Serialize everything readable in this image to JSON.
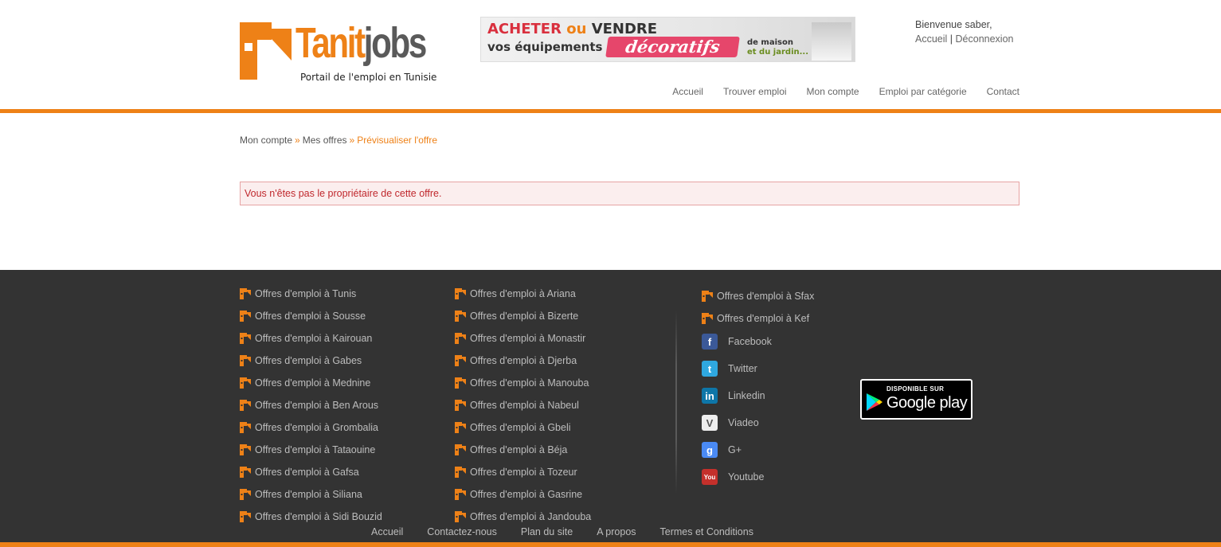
{
  "header": {
    "logo": {
      "word_part1": "Tanit",
      "word_part2": "jobs",
      "tagline": "Portail de l'emploi en Tunisie"
    },
    "banner": {
      "line1_a": "ACHETER",
      "line1_b": "ou",
      "line1_c": "VENDRE",
      "line2": "vos équipements",
      "highlight": "décoratifs",
      "side_line1": "de maison",
      "side_line2": "et du jardin..."
    },
    "welcome": {
      "greeting": "Bienvenue saber,",
      "home_link": "Accueil",
      "separator": "|",
      "logout_link": "Déconnexion"
    },
    "nav": [
      "Accueil",
      "Trouver emploi",
      "Mon compte",
      "Emploi par catégorie",
      "Contact"
    ]
  },
  "breadcrumb": {
    "item1": "Mon compte",
    "sep": "»",
    "item2": "Mes offres",
    "current": "Prévisualiser l'offre"
  },
  "alert": {
    "message": "Vous n'êtes pas le propriétaire de cette offre."
  },
  "footer": {
    "col1": [
      "Offres d'emploi à Tunis",
      "Offres d'emploi à Sousse",
      "Offres d'emploi à Kairouan",
      "Offres d'emploi à Gabes",
      "Offres d'emploi à Mednine",
      "Offres d'emploi à Ben Arous",
      "Offres d'emploi à Grombalia",
      "Offres d'emploi à Tataouine",
      "Offres d'emploi à Gafsa",
      "Offres d'emploi à Siliana",
      "Offres d'emploi à Sidi Bouzid"
    ],
    "col2": [
      "Offres d'emploi à Ariana",
      "Offres d'emploi à Bizerte",
      "Offres d'emploi à Monastir",
      "Offres d'emploi à Djerba",
      "Offres d'emploi à Manouba",
      "Offres d'emploi à Nabeul",
      "Offres d'emploi à Gbeli",
      "Offres d'emploi à Béja",
      "Offres d'emploi à Tozeur",
      "Offres d'emploi à Gasrine",
      "Offres d'emploi à Jandouba"
    ],
    "col3": [
      "Offres d'emploi à Sfax",
      "Offres d'emploi à Kef"
    ],
    "social": [
      {
        "label": "Facebook",
        "icon": "facebook-icon",
        "glyph": "f",
        "color": "#3b5998"
      },
      {
        "label": "Twitter",
        "icon": "twitter-icon",
        "glyph": "t",
        "color": "#2fa8e0"
      },
      {
        "label": "Linkedin",
        "icon": "linkedin-icon",
        "glyph": "in",
        "color": "#0e76a8"
      },
      {
        "label": "Viadeo",
        "icon": "viadeo-icon",
        "glyph": "V",
        "color": "#eeeeee"
      },
      {
        "label": "G+",
        "icon": "google-plus-icon",
        "glyph": "g",
        "color": "#4a8af4"
      },
      {
        "label": "Youtube",
        "icon": "youtube-icon",
        "glyph": "You",
        "color": "#c4302b"
      }
    ],
    "google_play": {
      "small": "DISPONIBLE SUR",
      "big": "Google play"
    },
    "bottom_nav": [
      "Accueil",
      "Contactez-nous",
      "Plan du site",
      "A propos",
      "Termes et Conditions"
    ]
  },
  "colors": {
    "brand_orange": "#ee8117",
    "footer_bg": "#333333",
    "alert_text": "#c0282d"
  }
}
